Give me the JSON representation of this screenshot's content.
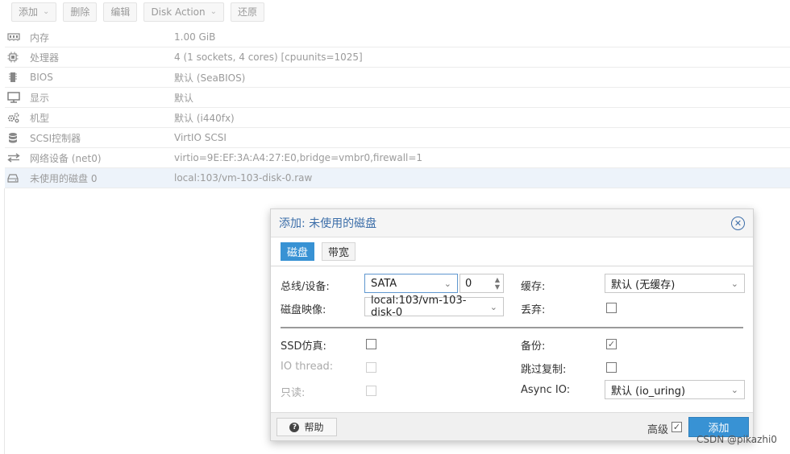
{
  "toolbar": {
    "add": "添加",
    "remove": "删除",
    "edit": "编辑",
    "disk_action": "Disk Action",
    "revert": "还原"
  },
  "hardware": [
    {
      "icon": "memory-icon",
      "name": "内存",
      "value": "1.00 GiB"
    },
    {
      "icon": "cpu-icon",
      "name": "处理器",
      "value": "4 (1 sockets, 4 cores) [cpuunits=1025]"
    },
    {
      "icon": "bios-icon",
      "name": "BIOS",
      "value": "默认 (SeaBIOS)"
    },
    {
      "icon": "display-icon",
      "name": "显示",
      "value": "默认"
    },
    {
      "icon": "gears-icon",
      "name": "机型",
      "value": "默认 (i440fx)"
    },
    {
      "icon": "database-icon",
      "name": "SCSI控制器",
      "value": "VirtIO SCSI"
    },
    {
      "icon": "network-icon",
      "name": "网络设备 (net0)",
      "value": "virtio=9E:EF:3A:A4:27:E0,bridge=vmbr0,firewall=1"
    },
    {
      "icon": "hdd-icon",
      "name": "未使用的磁盘 0",
      "value": "local:103/vm-103-disk-0.raw"
    }
  ],
  "dialog": {
    "title": "添加: 未使用的磁盘",
    "tabs": [
      "磁盘",
      "带宽"
    ],
    "bus_label": "总线/设备:",
    "bus_value": "SATA",
    "device_value": "0",
    "cache_label": "缓存:",
    "cache_value": "默认 (无缓存)",
    "image_label": "磁盘映像:",
    "image_value": "local:103/vm-103-disk-0",
    "discard_label": "丢弃:",
    "ssd_label": "SSD仿真:",
    "backup_label": "备份:",
    "iothread_label": "IO thread:",
    "skip_repl_label": "跳过复制:",
    "readonly_label": "只读:",
    "async_label": "Async IO:",
    "async_value": "默认 (io_uring)",
    "help": "帮助",
    "advanced": "高级",
    "add": "添加"
  },
  "watermark": "CSDN @pikazhi0"
}
